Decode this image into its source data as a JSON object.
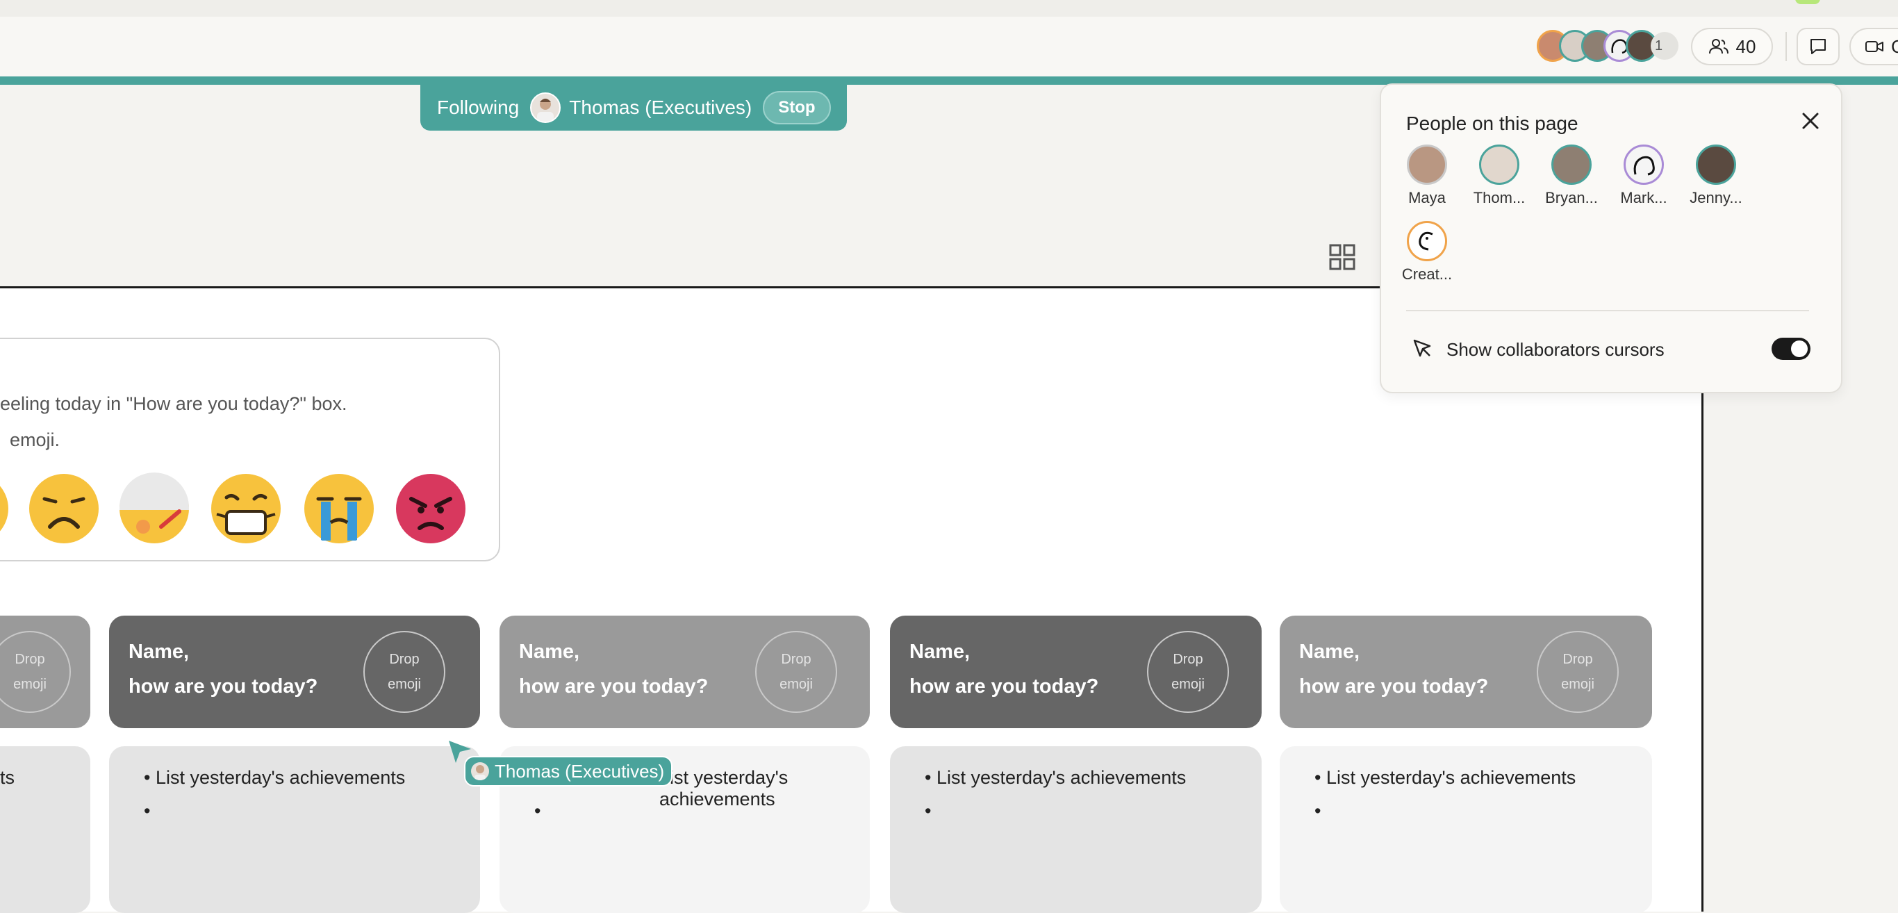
{
  "toolbar": {
    "avatar_overflow": "1",
    "people_count": "40",
    "video_label": "C"
  },
  "following": {
    "prefix": "Following",
    "user": "Thomas (Executives)",
    "stop_label": "Stop"
  },
  "instructions": {
    "line1": "eeling today in \"How are you today?\" box.",
    "line2": "emoji."
  },
  "cards": [
    {
      "title1": "",
      "title2": "",
      "drop1": "Drop",
      "drop2": "emoji",
      "item1": "ts",
      "item2": ""
    },
    {
      "title1": "Name,",
      "title2": "how are you today?",
      "drop1": "Drop",
      "drop2": "emoji",
      "item1": "• List yesterday's achievements",
      "item2": "•"
    },
    {
      "title1": "Name,",
      "title2": "how are you today?",
      "drop1": "Drop",
      "drop2": "emoji",
      "item1": "List yesterday's achievements",
      "item2": "•"
    },
    {
      "title1": "Name,",
      "title2": " how are you today?",
      "drop1": "Drop",
      "drop2": "emoji",
      "item1": "• List yesterday's achievements",
      "item2": "•"
    },
    {
      "title1": "Name,",
      "title2": "how are you today?",
      "drop1": "Drop",
      "drop2": "emoji",
      "item1": "• List yesterday's achievements",
      "item2": "•"
    }
  ],
  "cursor_label": "Thomas (Executives)",
  "people_panel": {
    "title": "People on this page",
    "people": [
      {
        "name": "Maya",
        "ring": "#c9c9c9"
      },
      {
        "name": "Thom...",
        "ring": "#4aa39b"
      },
      {
        "name": "Bryan...",
        "ring": "#4aa39b"
      },
      {
        "name": "Mark...",
        "ring": "#a98bd6"
      },
      {
        "name": "Jenny...",
        "ring": "#4aa39b"
      },
      {
        "name": "Creat...",
        "ring": "#f0a34a"
      }
    ],
    "cursors_label": "Show collaborators cursors",
    "cursors_enabled": true
  },
  "colors": {
    "accent": "#4aa39b",
    "card_dark": "#666666",
    "card_light": "#9a9a9a"
  }
}
